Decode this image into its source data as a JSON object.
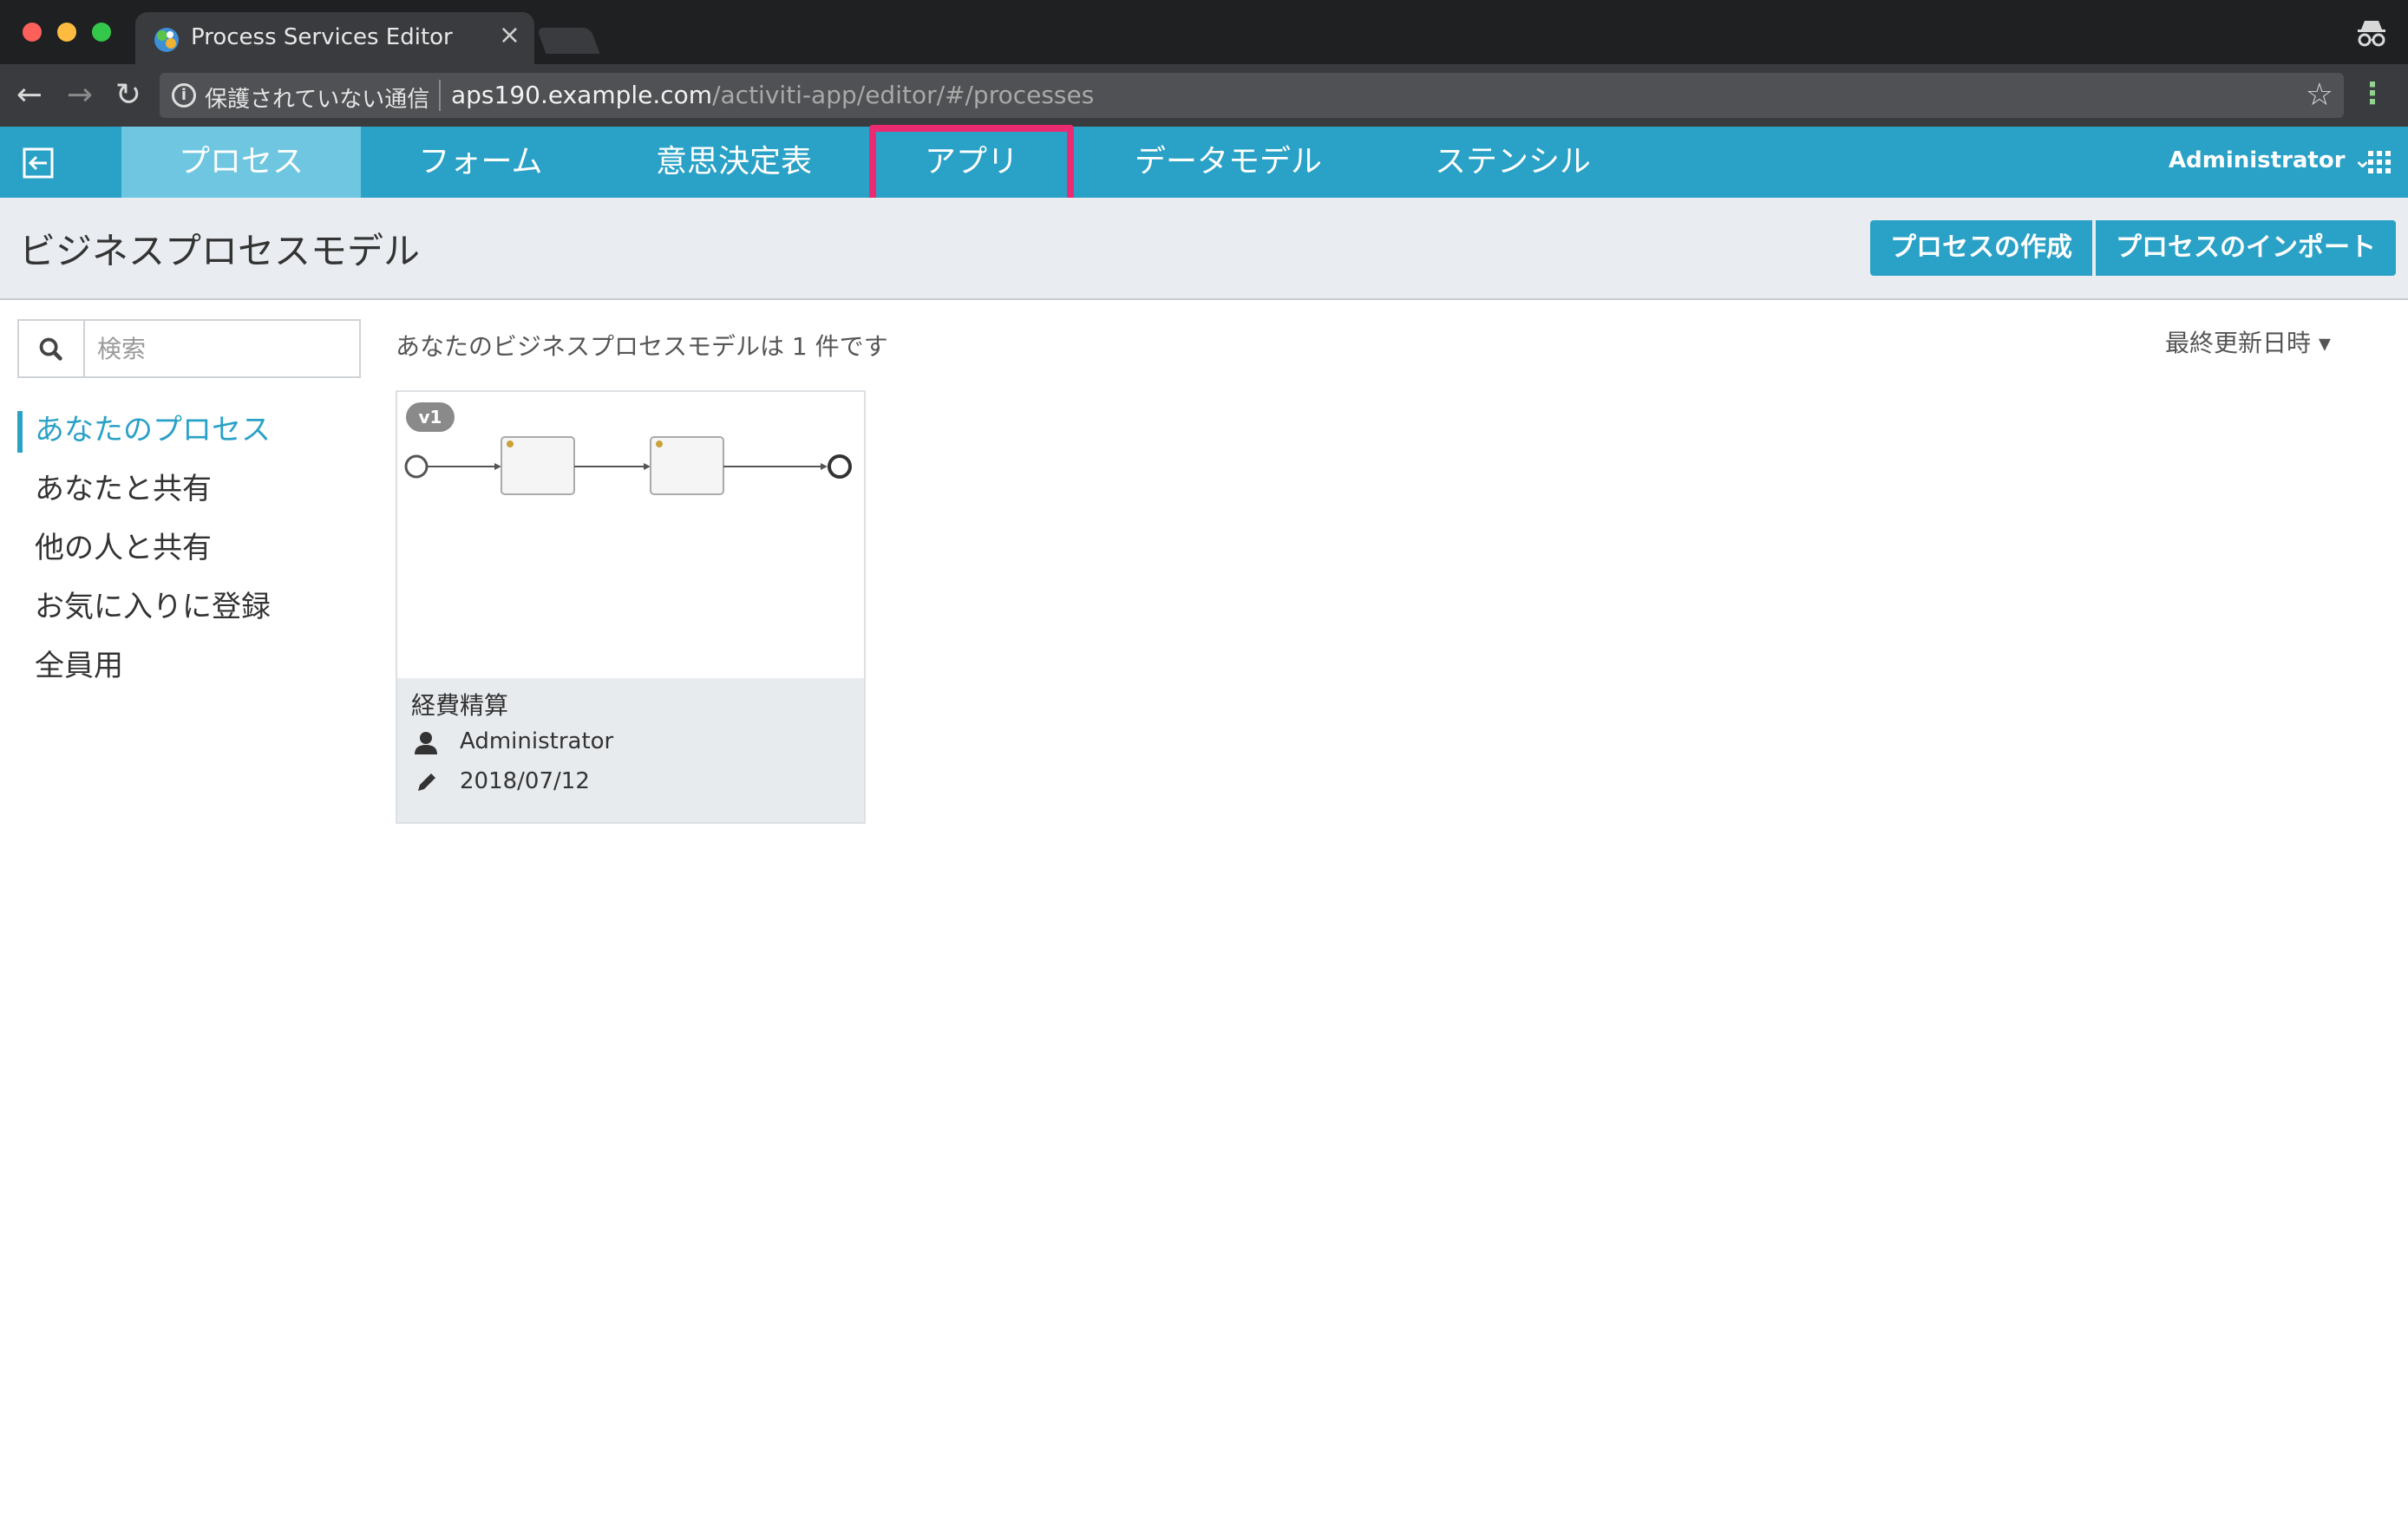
{
  "browser": {
    "tab_title": "Process Services Editor",
    "tab_close": "×",
    "security_warning": "保護されていない通信",
    "url_host": "aps190.example.com",
    "url_path": "/activiti-app/editor/#/processes"
  },
  "nav": {
    "items": [
      {
        "label": "プロセス",
        "active": true
      },
      {
        "label": "フォーム"
      },
      {
        "label": "意思決定表"
      },
      {
        "label": "アプリ",
        "highlighted": true
      },
      {
        "label": "データモデル"
      },
      {
        "label": "ステンシル"
      }
    ],
    "user": "Administrator"
  },
  "header": {
    "title": "ビジネスプロセスモデル",
    "create_button": "プロセスの作成",
    "import_button": "プロセスのインポート"
  },
  "sidebar": {
    "search_placeholder": "検索",
    "items": [
      {
        "label": "あなたのプロセス",
        "active": true
      },
      {
        "label": "あなたと共有"
      },
      {
        "label": "他の人と共有"
      },
      {
        "label": "お気に入りに登録"
      },
      {
        "label": "全員用"
      }
    ]
  },
  "content": {
    "count_text": "あなたのビジネスプロセスモデルは 1 件です",
    "sort_label": "最終更新日時",
    "cards": [
      {
        "version": "v1",
        "name": "経費精算",
        "owner": "Administrator",
        "date": "2018/07/12"
      }
    ]
  },
  "colors": {
    "accent": "#2aa1c6",
    "active_tab": "#6fc6e0",
    "highlight": "#ea2b72"
  }
}
